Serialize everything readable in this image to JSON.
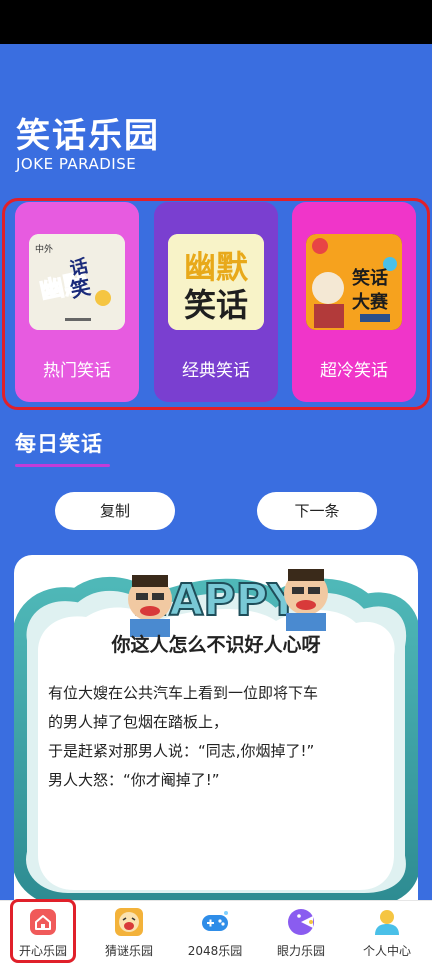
{
  "app": {
    "title": "笑话乐园",
    "subtitle": "JOKE PARADISE"
  },
  "categories": [
    {
      "label": "热门笑话",
      "thumb_text": "幽默笑话",
      "thumb_small": "中外",
      "color": "#e75be0"
    },
    {
      "label": "经典笑话",
      "thumb_text_top": "幽默",
      "thumb_text_bottom": "笑话",
      "color": "#7a3fd0"
    },
    {
      "label": "超冷笑话",
      "thumb_text_top": "笑话",
      "thumb_text_bottom": "大赛",
      "color": "#f035c9"
    }
  ],
  "daily": {
    "section_title": "每日笑话",
    "copy_label": "复制",
    "next_label": "下一条",
    "banner_text": "HAPPY",
    "joke_title": "你这人怎么不识好人心呀",
    "joke_lines": [
      "有位大嫂在公共汽车上看到一位即将下车",
      "的男人掉了包烟在踏板上，",
      "于是赶紧对那男人说：“同志,你烟掉了!”",
      "男人大怒：“你才阉掉了!”"
    ]
  },
  "tabbar": {
    "items": [
      {
        "label": "开心乐园",
        "icon": "home-icon",
        "active": true
      },
      {
        "label": "猜谜乐园",
        "icon": "laughing-face-icon"
      },
      {
        "label": "2048乐园",
        "icon": "gamepad-icon"
      },
      {
        "label": "眼力乐园",
        "icon": "pacman-icon"
      },
      {
        "label": "个人中心",
        "icon": "user-icon"
      }
    ]
  },
  "colors": {
    "background": "#3a6ee0",
    "accent_red": "#e0202a",
    "underline": "#c33cd8"
  }
}
